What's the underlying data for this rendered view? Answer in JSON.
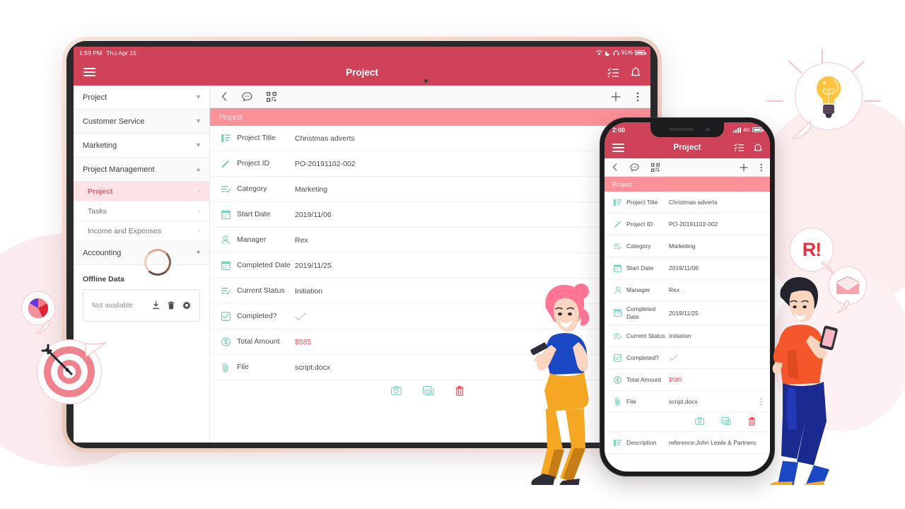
{
  "tablet": {
    "statusbar": {
      "time": "1:59 PM",
      "date": "Thu Apr 15",
      "battery_percent": "91%",
      "icons": [
        "wifi-icon",
        "moon-icon",
        "headphones-icon",
        "battery-icon"
      ]
    },
    "appbar": {
      "title": "Project",
      "menu_icon": "hamburger-icon",
      "checklist_icon": "checklist-icon",
      "bell_icon": "bell-icon"
    },
    "sidebar": {
      "groups": [
        {
          "label": "Project",
          "expanded": false
        },
        {
          "label": "Customer Service",
          "expanded": false
        },
        {
          "label": "Marketing",
          "expanded": false
        },
        {
          "label": "Project Management",
          "expanded": true
        },
        {
          "label": "Accounting",
          "expanded": false
        }
      ],
      "sub_items": [
        {
          "label": "Project",
          "active": true
        },
        {
          "label": "Tasks",
          "active": false
        },
        {
          "label": "Income and Expenses",
          "active": false
        }
      ],
      "offline": {
        "title": "Offline Data",
        "status": "Not available",
        "icons": [
          "download-icon",
          "trash-icon",
          "gear-icon"
        ]
      }
    },
    "toolbar": {
      "back_icon": "back-chevron-icon",
      "chat_icon": "chat-bubble-icon",
      "qr_icon": "qr-code-icon",
      "add_icon": "plus-icon",
      "more_icon": "kebab-menu-icon"
    },
    "section_title": "Project",
    "fields": [
      {
        "icon": "text-lines-icon",
        "label": "Project Title",
        "value": "Christmas adverts"
      },
      {
        "icon": "magic-wand-icon",
        "label": "Project ID",
        "value": "PO-20191102-002"
      },
      {
        "icon": "list-check-icon",
        "label": "Category",
        "value": "Marketing"
      },
      {
        "icon": "calendar-icon",
        "label": "Start Date",
        "value": "2019/11/06"
      },
      {
        "icon": "person-icon",
        "label": "Manager",
        "value": "Rex"
      },
      {
        "icon": "calendar-icon",
        "label": "Completed Date",
        "value": "2019/11/25"
      },
      {
        "icon": "list-check-icon",
        "label": "Current Status",
        "value": "Initiation"
      },
      {
        "icon": "checkbox-icon",
        "label": "Completed?",
        "value": "checkmark-icon"
      },
      {
        "icon": "dollar-icon",
        "label": "Total Amount",
        "value": "$585"
      },
      {
        "icon": "paperclip-icon",
        "label": "File",
        "value": "script.docx"
      }
    ],
    "media_actions": [
      "camera-icon",
      "gallery-icon",
      "trash-icon"
    ]
  },
  "phone": {
    "statusbar": {
      "time": "2:00",
      "network": "4G",
      "icons": [
        "signal-bars-icon",
        "battery-icon"
      ]
    },
    "appbar": {
      "title": "Project",
      "menu_icon": "hamburger-icon",
      "checklist_icon": "checklist-icon",
      "bell_icon": "bell-icon"
    },
    "toolbar": {
      "back_icon": "back-chevron-icon",
      "chat_icon": "chat-bubble-icon",
      "qr_icon": "qr-code-icon",
      "add_icon": "plus-icon",
      "more_icon": "kebab-menu-icon"
    },
    "section_title": "Project",
    "fields": [
      {
        "icon": "text-lines-icon",
        "label": "Project Title",
        "value": "Christmas adverts"
      },
      {
        "icon": "magic-wand-icon",
        "label": "Project ID",
        "value": "PO-20191102-002"
      },
      {
        "icon": "list-check-icon",
        "label": "Category",
        "value": "Marketing"
      },
      {
        "icon": "calendar-icon",
        "label": "Start Date",
        "value": "2019/11/06"
      },
      {
        "icon": "person-icon",
        "label": "Manager",
        "value": "Rex"
      },
      {
        "icon": "calendar-icon",
        "label": "Completed Date",
        "value": "2019/11/25"
      },
      {
        "icon": "list-check-icon",
        "label": "Current Status",
        "value": "Initiation"
      },
      {
        "icon": "checkbox-icon",
        "label": "Completed?",
        "value": "checkmark-icon"
      },
      {
        "icon": "dollar-icon",
        "label": "Total Amount",
        "value": "$585"
      },
      {
        "icon": "paperclip-icon",
        "label": "File",
        "value": "script.docx"
      },
      {
        "icon": "text-lines-icon",
        "label": "Description",
        "value": "reference:John Lewis & Partners"
      }
    ],
    "media_actions": [
      "camera-icon",
      "gallery-icon",
      "trash-icon"
    ]
  },
  "decorations": {
    "lightbulb_bubble": "lightbulb-icon",
    "pie_chart_bubble": "pie-chart-icon",
    "target_bubble": "target-dartboard-icon",
    "alert_bubble_text": "R!",
    "envelope_bubble": "envelope-icon",
    "person_left": "woman-with-phone-illustration",
    "person_right": "man-with-phone-illustration"
  },
  "colors": {
    "brand_red": "#d04257",
    "section_pink": "#fa9098",
    "accent_teal": "#7ecfc0",
    "money_red": "#ef4b5e",
    "active_pink_bg": "#fde3e6",
    "blob_pink": "#fdeef0"
  }
}
